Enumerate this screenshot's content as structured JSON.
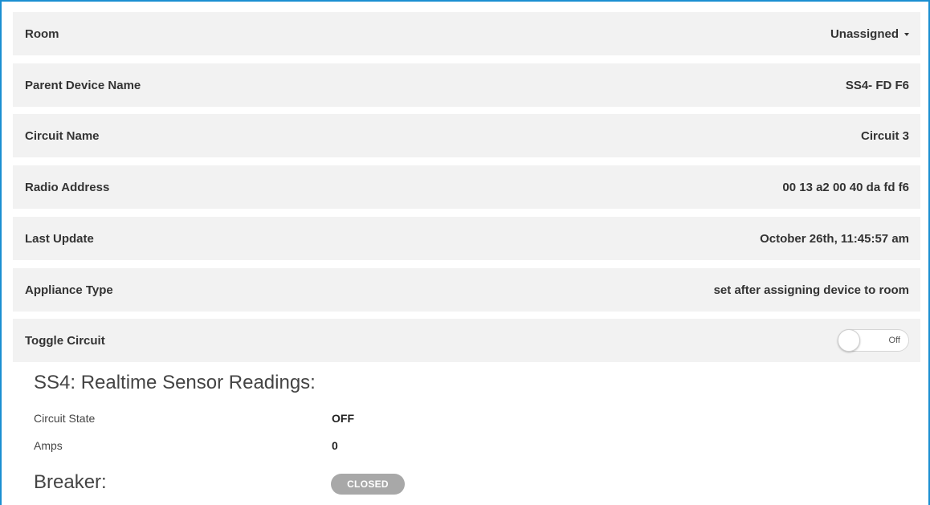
{
  "details": {
    "room": {
      "label": "Room",
      "value": "Unassigned"
    },
    "parent_device_name": {
      "label": "Parent Device Name",
      "value": "SS4- FD F6"
    },
    "circuit_name": {
      "label": "Circuit Name",
      "value": "Circuit 3"
    },
    "radio_address": {
      "label": "Radio Address",
      "value": "00 13 a2 00 40 da fd f6"
    },
    "last_update": {
      "label": "Last Update",
      "value": "October 26th, 11:45:57 am"
    },
    "appliance_type": {
      "label": "Appliance Type",
      "value": "set after assigning device to room"
    },
    "toggle_circuit": {
      "label": "Toggle Circuit",
      "state_label": "Off",
      "on": false
    }
  },
  "readings": {
    "title": "SS4: Realtime Sensor Readings:",
    "circuit_state": {
      "label": "Circuit State",
      "value": "OFF"
    },
    "amps": {
      "label": "Amps",
      "value": "0"
    },
    "breaker": {
      "label": "Breaker:",
      "status": "CLOSED"
    }
  },
  "colors": {
    "frame_border": "#1a8fd1",
    "row_background": "#f2f2f2",
    "badge_background": "#a8a8a8"
  }
}
